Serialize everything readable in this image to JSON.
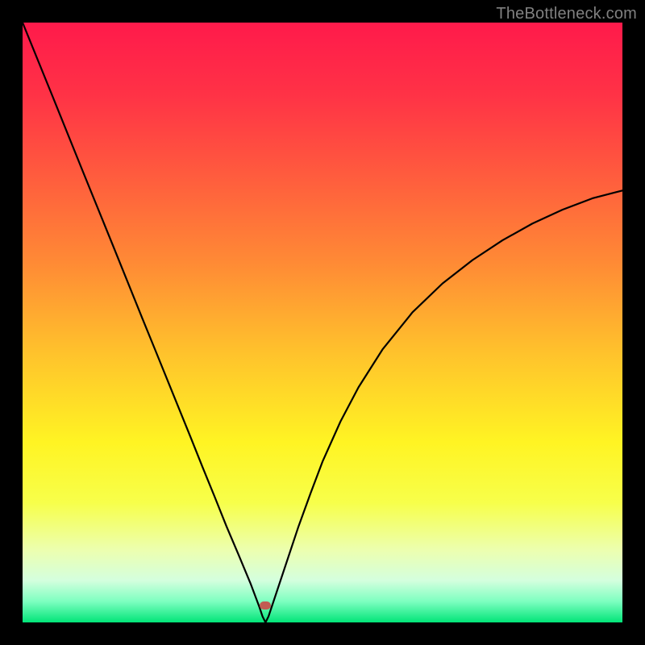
{
  "watermark": "TheBottleneck.com",
  "marker": {
    "color": "#c15b53",
    "x_frac": 0.405,
    "y_frac": 0.972
  },
  "gradient": {
    "stops": [
      {
        "offset": 0.0,
        "color": "#ff1a4b"
      },
      {
        "offset": 0.12,
        "color": "#ff3246"
      },
      {
        "offset": 0.25,
        "color": "#ff5a3e"
      },
      {
        "offset": 0.4,
        "color": "#ff8a35"
      },
      {
        "offset": 0.55,
        "color": "#ffc22c"
      },
      {
        "offset": 0.7,
        "color": "#fff423"
      },
      {
        "offset": 0.8,
        "color": "#f7ff4a"
      },
      {
        "offset": 0.88,
        "color": "#ecffb0"
      },
      {
        "offset": 0.93,
        "color": "#d4ffde"
      },
      {
        "offset": 0.965,
        "color": "#7dffc0"
      },
      {
        "offset": 1.0,
        "color": "#02e578"
      }
    ]
  },
  "chart_data": {
    "type": "line",
    "title": "",
    "xlabel": "",
    "ylabel": "",
    "xlim": [
      0,
      1
    ],
    "ylim": [
      0,
      1
    ],
    "notch_x": 0.405,
    "left_branch_start_y": 1.0,
    "right_branch_end_y": 0.72,
    "series": [
      {
        "name": "curve",
        "x": [
          0.0,
          0.05,
          0.1,
          0.15,
          0.2,
          0.22,
          0.25,
          0.28,
          0.3,
          0.32,
          0.34,
          0.36,
          0.38,
          0.395,
          0.4,
          0.405,
          0.41,
          0.42,
          0.44,
          0.46,
          0.48,
          0.5,
          0.53,
          0.56,
          0.6,
          0.65,
          0.7,
          0.75,
          0.8,
          0.85,
          0.9,
          0.95,
          1.0
        ],
        "y": [
          1.0,
          0.877,
          0.753,
          0.63,
          0.506,
          0.457,
          0.383,
          0.309,
          0.259,
          0.21,
          0.16,
          0.113,
          0.065,
          0.025,
          0.01,
          0.0,
          0.01,
          0.04,
          0.1,
          0.16,
          0.215,
          0.268,
          0.335,
          0.392,
          0.455,
          0.517,
          0.565,
          0.604,
          0.637,
          0.665,
          0.688,
          0.707,
          0.72
        ]
      }
    ]
  }
}
